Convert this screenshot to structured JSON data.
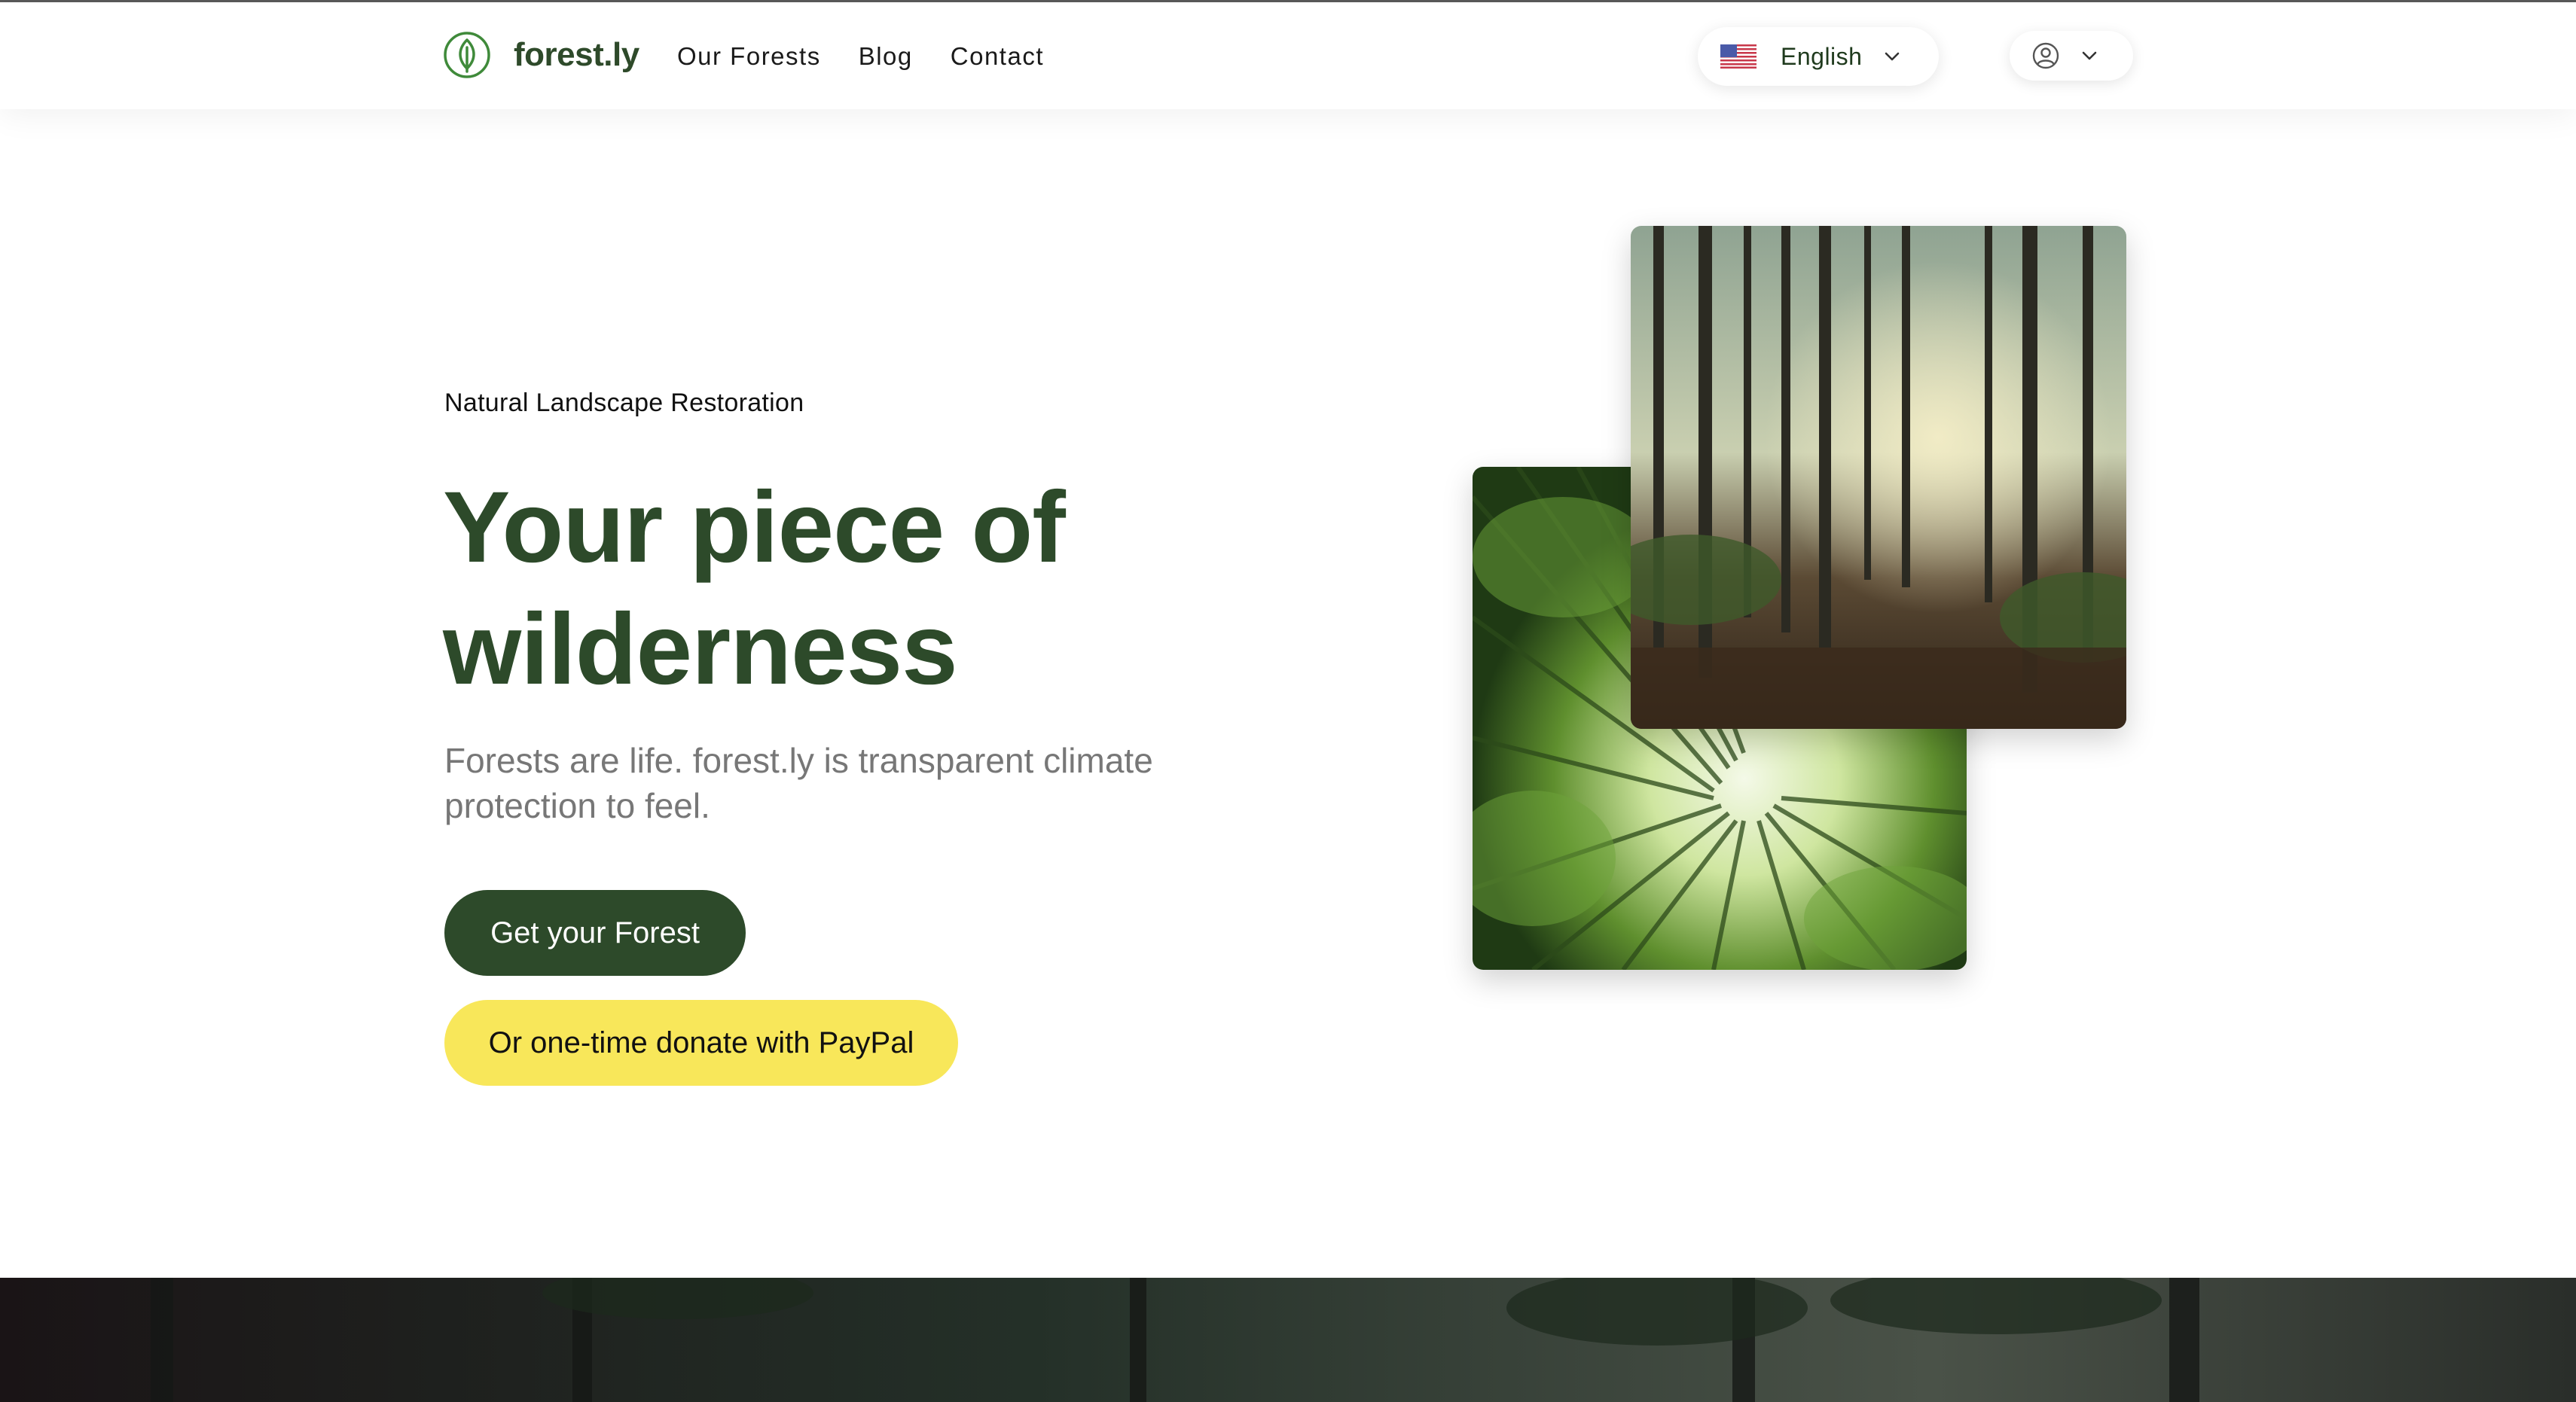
{
  "header": {
    "brand": "forest.ly",
    "nav": [
      {
        "label": "Our Forests"
      },
      {
        "label": "Blog"
      },
      {
        "label": "Contact"
      }
    ],
    "language": {
      "label": "English",
      "flag_icon": "us-flag-icon"
    },
    "account_icon": "user-circle-icon"
  },
  "hero": {
    "eyebrow": "Natural Landscape Restoration",
    "title": "Your piece of wilderness",
    "subtitle": "Forests are life. forest.ly is transparent climate protection to feel.",
    "primary_button": "Get your Forest",
    "paypal_button": "Or one-time donate with PayPal"
  },
  "colors": {
    "brand_green": "#2d4a2a",
    "paypal_yellow": "#f8e75a",
    "subtitle_gray": "#777777"
  }
}
